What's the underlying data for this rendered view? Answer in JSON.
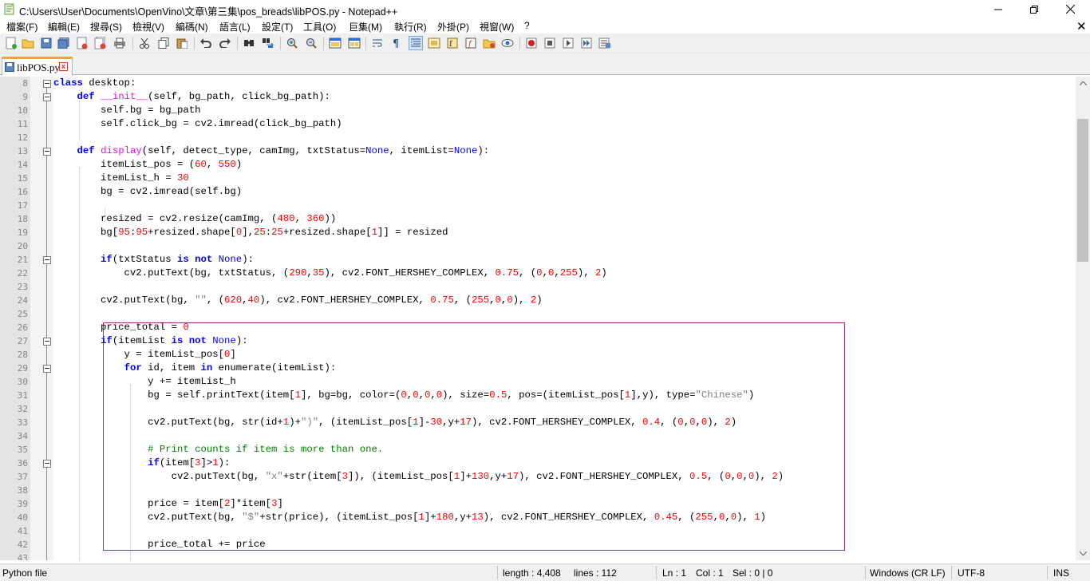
{
  "window": {
    "title": "C:\\Users\\User\\Documents\\OpenVino\\文章\\第三集\\pos_breads\\libPOS.py - Notepad++",
    "minimize_glyph": "—",
    "maximize_glyph": "❐",
    "close_glyph": "✕"
  },
  "menu": {
    "items": [
      "檔案(F)",
      "編輯(E)",
      "搜尋(S)",
      "檢視(V)",
      "編碼(N)",
      "語言(L)",
      "設定(T)",
      "工具(O)",
      "巨集(M)",
      "執行(R)",
      "外掛(P)",
      "視窗(W)",
      "?"
    ],
    "close_doc_glyph": "✕"
  },
  "toolbar": {
    "icons": [
      "new-file-icon",
      "open-file-icon",
      "save-icon",
      "save-all-icon",
      "close-icon",
      "close-all-icon",
      "print-icon",
      "cut-icon",
      "copy-icon",
      "paste-icon",
      "undo-icon",
      "redo-icon",
      "find-icon",
      "replace-icon",
      "zoom-in-icon",
      "zoom-out-icon",
      "sync-vertical-icon",
      "sync-horizontal-icon",
      "word-wrap-icon",
      "show-all-chars-icon",
      "indent-guide-icon",
      "doc-map-icon",
      "function-list-icon",
      "folder-workspace-icon",
      "doc-list-icon",
      "monitoring-icon",
      "record-macro-icon",
      "stop-record-icon",
      "play-macro-icon",
      "run-macro-multiple-icon",
      "save-macro-icon"
    ]
  },
  "tab": {
    "label": "libPOS.py",
    "close_glyph": "x"
  },
  "editor": {
    "lines": [
      {
        "n": "8"
      },
      {
        "n": "9"
      },
      {
        "n": "10"
      },
      {
        "n": "11"
      },
      {
        "n": "12"
      },
      {
        "n": "13"
      },
      {
        "n": "14"
      },
      {
        "n": "15"
      },
      {
        "n": "16"
      },
      {
        "n": "17"
      },
      {
        "n": "18"
      },
      {
        "n": "19"
      },
      {
        "n": "20"
      },
      {
        "n": "21"
      },
      {
        "n": "22"
      },
      {
        "n": "23"
      },
      {
        "n": "24"
      },
      {
        "n": "25"
      },
      {
        "n": "26"
      },
      {
        "n": "27"
      },
      {
        "n": "28"
      },
      {
        "n": "29"
      },
      {
        "n": "30"
      },
      {
        "n": "31"
      },
      {
        "n": "32"
      },
      {
        "n": "33"
      },
      {
        "n": "34"
      },
      {
        "n": "35"
      },
      {
        "n": "36"
      },
      {
        "n": "37"
      },
      {
        "n": "38"
      },
      {
        "n": "39"
      },
      {
        "n": "40"
      },
      {
        "n": "41"
      },
      {
        "n": "42"
      },
      {
        "n": "43"
      }
    ],
    "code": {
      "l8": [
        "class",
        " desktop:"
      ],
      "l9": [
        "    ",
        "def",
        " ",
        "__init__",
        "(self, bg_path, click_bg_path):"
      ],
      "l10": [
        "        self.bg = bg_path"
      ],
      "l11": [
        "        self.click_bg = cv2.imread(click_bg_path)"
      ],
      "l13": [
        "    ",
        "def",
        " ",
        "display",
        "(self, detect_type, camImg, txtStatus=",
        "None",
        ", itemList=",
        "None",
        "):"
      ],
      "l14": [
        "        itemList_pos = (",
        "60",
        ", ",
        "550",
        ")"
      ],
      "l15": [
        "        itemList_h = ",
        "30"
      ],
      "l16": [
        "        bg = cv2.imread(self.bg)"
      ],
      "l18": [
        "        resized = cv2.resize(camImg, (",
        "480",
        ", ",
        "360",
        "))"
      ],
      "l19": [
        "        bg[",
        "95",
        ":",
        "95",
        "+resized.shape[",
        "0",
        "],",
        "25",
        ":",
        "25",
        "+resized.shape[",
        "1",
        "]] = resized"
      ],
      "l21": [
        "        ",
        "if",
        "(txtStatus ",
        "is not",
        " ",
        "None",
        "):"
      ],
      "l22": [
        "            cv2.putText(bg, txtStatus, (",
        "290",
        ",",
        "35",
        "), cv2.FONT_HERSHEY_COMPLEX, ",
        "0.75",
        ", (",
        "0",
        ",",
        "0",
        ",",
        "255",
        "), ",
        "2",
        ")"
      ],
      "l24": [
        "        cv2.putText(bg, ",
        "\"\"",
        ", (",
        "620",
        ",",
        "40",
        "), cv2.FONT_HERSHEY_COMPLEX, ",
        "0.75",
        ", (",
        "255",
        ",",
        "0",
        ",",
        "0",
        "), ",
        "2",
        ")"
      ],
      "l26": [
        "        price_total = ",
        "0"
      ],
      "l27": [
        "        ",
        "if",
        "(itemList ",
        "is not",
        " ",
        "None",
        "):"
      ],
      "l28": [
        "            y = itemList_pos[",
        "0",
        "]"
      ],
      "l29": [
        "            ",
        "for",
        " id, item ",
        "in",
        " enumerate(itemList):"
      ],
      "l30": [
        "                y += itemList_h"
      ],
      "l31": [
        "                bg = self.printText(item[",
        "1",
        "], bg=bg, color=(",
        "0",
        ",",
        "0",
        ",",
        "0",
        ",",
        "0",
        "), size=",
        "0.5",
        ", pos=(itemList_pos[",
        "1",
        "],y), type=",
        "\"Chinese\"",
        ")"
      ],
      "l33": [
        "                cv2.putText(bg, str(id+",
        "1",
        ")+",
        "\")\"",
        ", (itemList_pos[",
        "1",
        "]-",
        "30",
        ",y+",
        "17",
        "), cv2.FONT_HERSHEY_COMPLEX, ",
        "0.4",
        ", (",
        "0",
        ",",
        "0",
        ",",
        "0",
        "), ",
        "2",
        ")"
      ],
      "l35": [
        "                ",
        "# Print counts if item is more than one."
      ],
      "l36": [
        "                ",
        "if",
        "(item[",
        "3",
        "]>",
        "1",
        "):"
      ],
      "l37": [
        "                    cv2.putText(bg, ",
        "\"x\"",
        "+str(item[",
        "3",
        "]), (itemList_pos[",
        "1",
        "]+",
        "130",
        ",y+",
        "17",
        "), cv2.FONT_HERSHEY_COMPLEX, ",
        "0.5",
        ", (",
        "0",
        ",",
        "0",
        ",",
        "0",
        "), ",
        "2",
        ")"
      ],
      "l39": [
        "                price = item[",
        "2",
        "]*item[",
        "3",
        "]"
      ],
      "l40": [
        "                cv2.putText(bg, ",
        "\"$\"",
        "+str(price), (itemList_pos[",
        "1",
        "]+",
        "180",
        ",y+",
        "13",
        "), cv2.FONT_HERSHEY_COMPLEX, ",
        "0.45",
        ", (",
        "255",
        ",",
        "0",
        ",",
        "0",
        "), ",
        "1",
        ")"
      ],
      "l42": [
        "                price_total += price"
      ]
    }
  },
  "status": {
    "file_type": "Python file",
    "length": "length : 4,408",
    "lines": "lines : 112",
    "ln": "Ln : 1",
    "col": "Col : 1",
    "sel": "Sel : 0 | 0",
    "eol": "Windows (CR LF)",
    "encoding": "UTF-8",
    "mode": "INS"
  },
  "colors": {
    "keyword": "#0000ff",
    "function": "#ff00ff",
    "number": "#ff0000",
    "string": "#808080",
    "comment": "#008000",
    "tab_accent": "#f2a43a",
    "selection_border": "#9a2f8c"
  }
}
